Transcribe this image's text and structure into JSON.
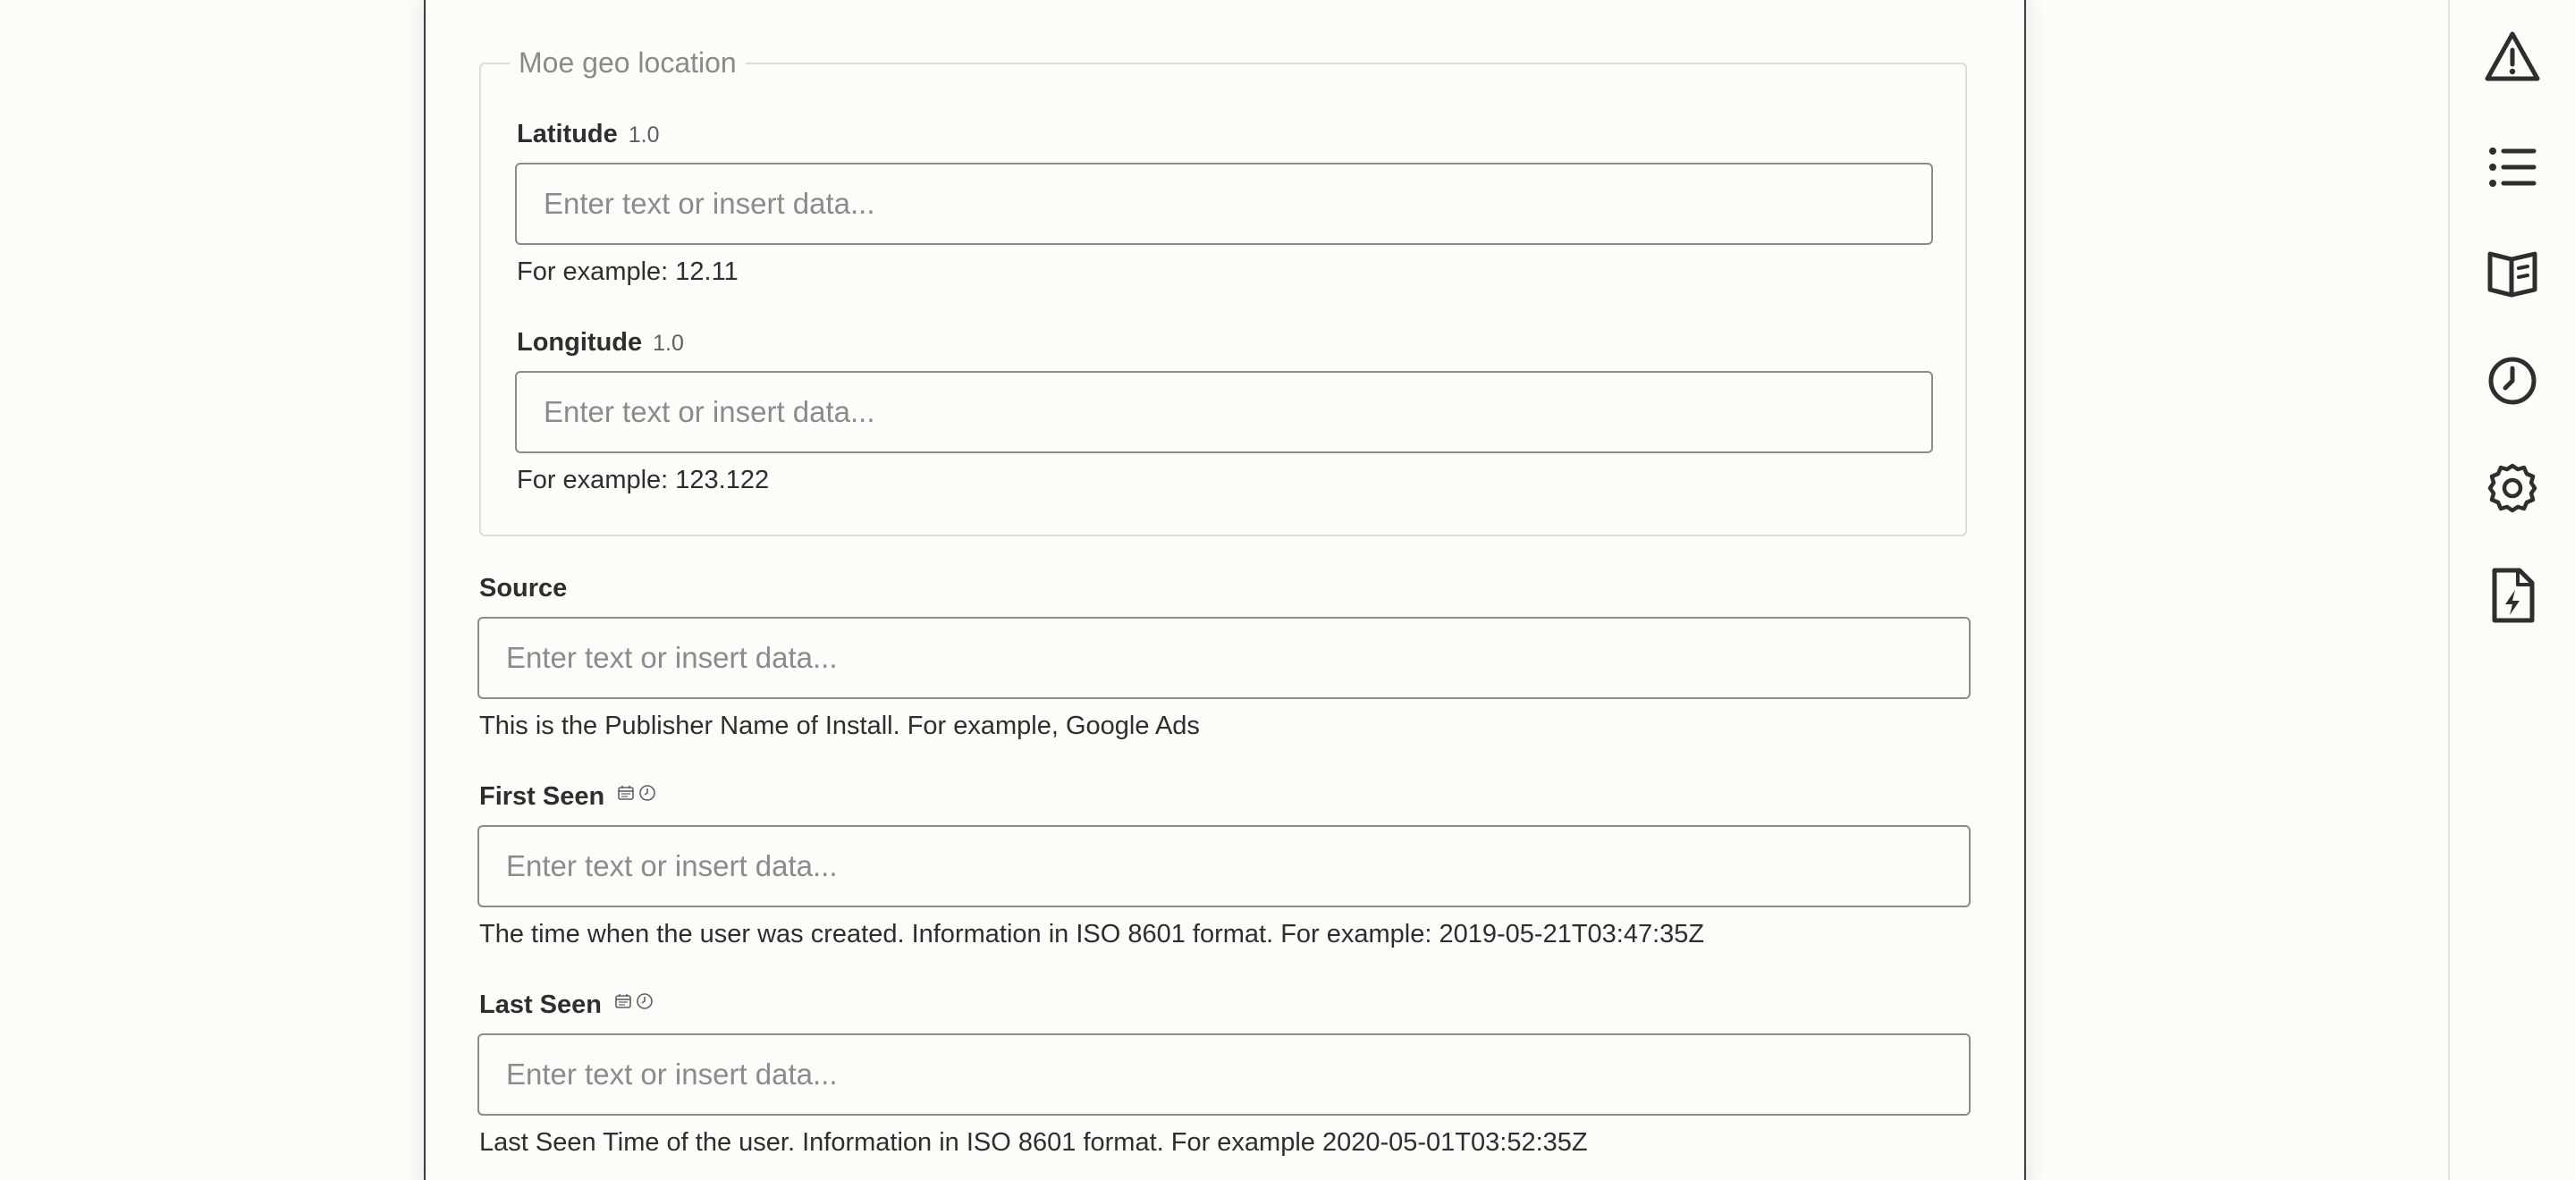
{
  "geo_group": {
    "legend": "Moe geo location",
    "latitude": {
      "label": "Latitude",
      "version": "1.0",
      "placeholder": "Enter text or insert data...",
      "help": "For example: 12.11"
    },
    "longitude": {
      "label": "Longitude",
      "version": "1.0",
      "placeholder": "Enter text or insert data...",
      "help": "For example: 123.122"
    }
  },
  "source": {
    "label": "Source",
    "placeholder": "Enter text or insert data...",
    "help": "This is the Publisher Name of Install. For example, Google Ads"
  },
  "first_seen": {
    "label": "First Seen",
    "icons": [
      "calendar-icon",
      "clock-icon"
    ],
    "placeholder": "Enter text or insert data...",
    "help": "The time when the user was created. Information in ISO 8601 format. For example: 2019-05-21T03:47:35Z"
  },
  "last_seen": {
    "label": "Last Seen",
    "icons": [
      "calendar-icon",
      "clock-icon"
    ],
    "placeholder": "Enter text or insert data...",
    "help": "Last Seen Time of the user. Information in ISO 8601 format. For example 2020-05-01T03:52:35Z"
  },
  "rail": {
    "items": [
      "warning-icon",
      "list-icon",
      "book-icon",
      "history-clock-icon",
      "settings-gear-icon",
      "zap-file-icon"
    ]
  },
  "colors": {
    "background": "#fdfcf9",
    "text": "#2d2e2e",
    "muted": "#8a8b8e",
    "border": "#8a8b8e"
  }
}
